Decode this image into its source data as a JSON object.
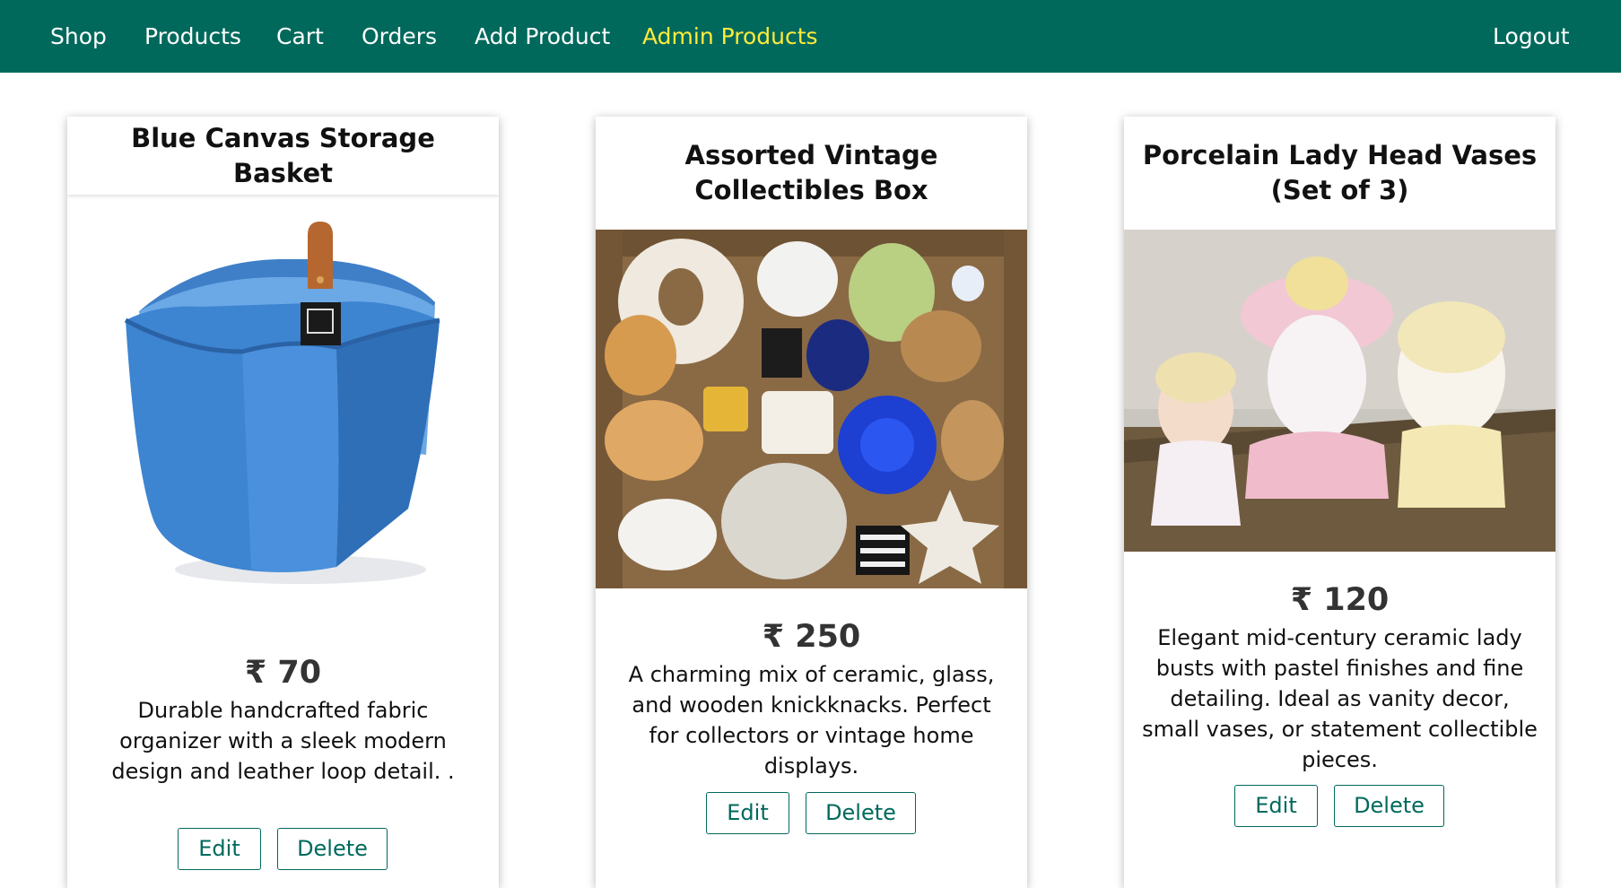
{
  "nav": {
    "shop": "Shop",
    "products": "Products",
    "cart": "Cart",
    "orders": "Orders",
    "add_product": "Add Product",
    "admin_products": "Admin Products",
    "logout": "Logout"
  },
  "colors": {
    "header_bg": "#00695c",
    "active_nav": "#ffeb3b",
    "button_border": "#00695c"
  },
  "products": [
    {
      "title": "Blue Canvas Storage Basket",
      "price": "₹ 70",
      "description": "Durable handcrafted fabric organizer with a sleek modern design and leather loop detail. .",
      "edit_label": "Edit",
      "delete_label": "Delete"
    },
    {
      "title": "Assorted Vintage Collectibles Box",
      "price": "₹ 250",
      "description": "A charming mix of ceramic, glass, and wooden knickknacks. Perfect for collectors or vintage home displays.",
      "edit_label": "Edit",
      "delete_label": "Delete"
    },
    {
      "title": "Porcelain Lady Head Vases (Set of 3)",
      "price": "₹ 120",
      "description": "Elegant mid-century ceramic lady busts with pastel finishes and fine detailing. Ideal as vanity decor, small vases, or statement collectible pieces.",
      "edit_label": "Edit",
      "delete_label": "Delete"
    }
  ]
}
